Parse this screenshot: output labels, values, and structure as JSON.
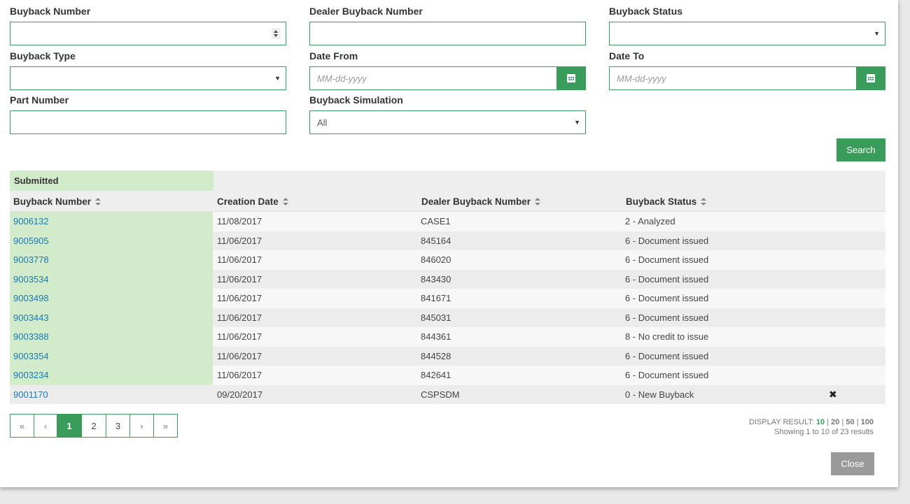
{
  "filters": {
    "buyback_number": {
      "label": "Buyback Number",
      "value": ""
    },
    "dealer_buyback_number": {
      "label": "Dealer Buyback Number",
      "value": ""
    },
    "buyback_status": {
      "label": "Buyback Status",
      "value": ""
    },
    "buyback_type": {
      "label": "Buyback Type",
      "value": ""
    },
    "date_from": {
      "label": "Date From",
      "placeholder": "MM-dd-yyyy"
    },
    "date_to": {
      "label": "Date To",
      "placeholder": "MM-dd-yyyy"
    },
    "part_number": {
      "label": "Part Number",
      "value": ""
    },
    "buyback_simulation": {
      "label": "Buyback Simulation",
      "value": "All"
    }
  },
  "search_label": "Search",
  "table": {
    "group_label": "Submitted",
    "columns": [
      "Buyback Number",
      "Creation Date",
      "Dealer Buyback Number",
      "Buyback Status"
    ],
    "rows": [
      {
        "number": "9006132",
        "date": "11/08/2017",
        "dealer": "CASE1",
        "status": "2 - Analyzed",
        "highlight": true
      },
      {
        "number": "9005905",
        "date": "11/06/2017",
        "dealer": "845164",
        "status": "6 - Document issued",
        "highlight": true
      },
      {
        "number": "9003778",
        "date": "11/06/2017",
        "dealer": "846020",
        "status": "6 - Document issued",
        "highlight": true
      },
      {
        "number": "9003534",
        "date": "11/06/2017",
        "dealer": "843430",
        "status": "6 - Document issued",
        "highlight": true
      },
      {
        "number": "9003498",
        "date": "11/06/2017",
        "dealer": "841671",
        "status": "6 - Document issued",
        "highlight": true
      },
      {
        "number": "9003443",
        "date": "11/06/2017",
        "dealer": "845031",
        "status": "6 - Document issued",
        "highlight": true
      },
      {
        "number": "9003388",
        "date": "11/06/2017",
        "dealer": "844361",
        "status": "8 - No credit to issue",
        "highlight": true
      },
      {
        "number": "9003354",
        "date": "11/06/2017",
        "dealer": "844528",
        "status": "6 - Document issued",
        "highlight": true
      },
      {
        "number": "9003234",
        "date": "11/06/2017",
        "dealer": "842641",
        "status": "6 - Document issued",
        "highlight": true
      },
      {
        "number": "9001170",
        "date": "09/20/2017",
        "dealer": "CSPSDM",
        "status": "0 - New Buyback",
        "highlight": false,
        "delete": "✖"
      }
    ]
  },
  "pagination": {
    "first": "«",
    "prev": "‹",
    "pages": [
      "1",
      "2",
      "3"
    ],
    "active": "1",
    "next": "›",
    "last": "»"
  },
  "display_result": {
    "label": "DISPLAY RESULT:",
    "options": [
      "10",
      "20",
      "50",
      "100"
    ],
    "active": "10",
    "separator": "|",
    "showing": "Showing 1 to 10 of 23 results"
  },
  "close_label": "Close",
  "colors": {
    "accent": "#3a9c5a",
    "highlight": "#d2ebcb",
    "link": "#1a7ab0",
    "close_button": "#9a9a9a"
  }
}
